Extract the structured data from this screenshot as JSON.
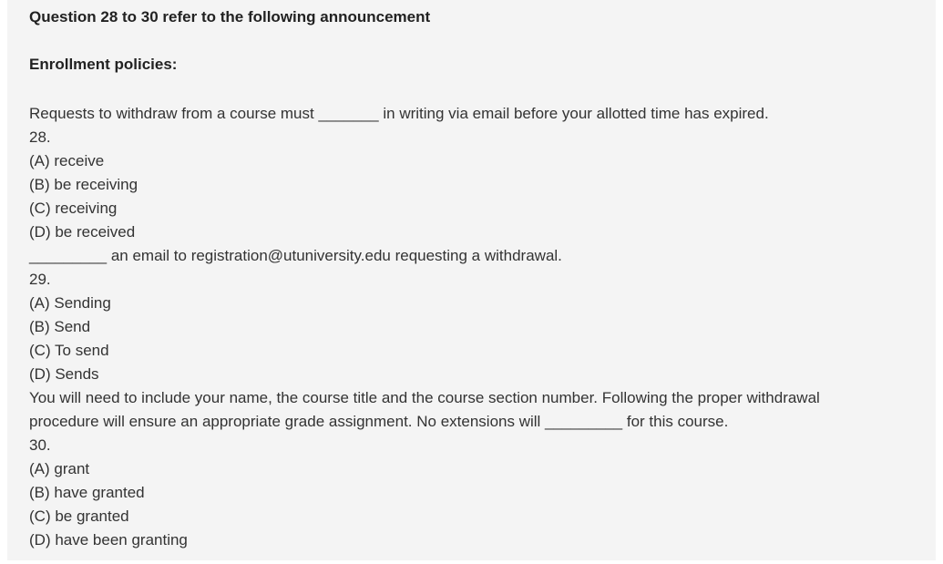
{
  "heading": "Question 28 to 30 refer to the following announcement",
  "subheading": "Enrollment policies:",
  "passage1": "Requests to withdraw from a course must _______ in writing via email before your allotted time has expired.",
  "q28": {
    "number": "28.",
    "options": [
      "(A) receive",
      "(B) be receiving",
      "(C) receiving",
      "(D) be received"
    ]
  },
  "passage2": "_________ an email to registration@utuniversity.edu requesting a withdrawal.",
  "q29": {
    "number": "29.",
    "options": [
      "(A) Sending",
      "(B) Send",
      "(C) To send",
      "(D) Sends"
    ]
  },
  "passage3_line1": "You will need to include your name, the course title and the course section number. Following the proper withdrawal",
  "passage3_line2": "procedure will ensure an appropriate grade assignment. No extensions will _________ for this course.",
  "q30": {
    "number": "30.",
    "options": [
      "(A) grant",
      "(B) have granted",
      "(C) be granted",
      "(D) have been granting"
    ]
  }
}
